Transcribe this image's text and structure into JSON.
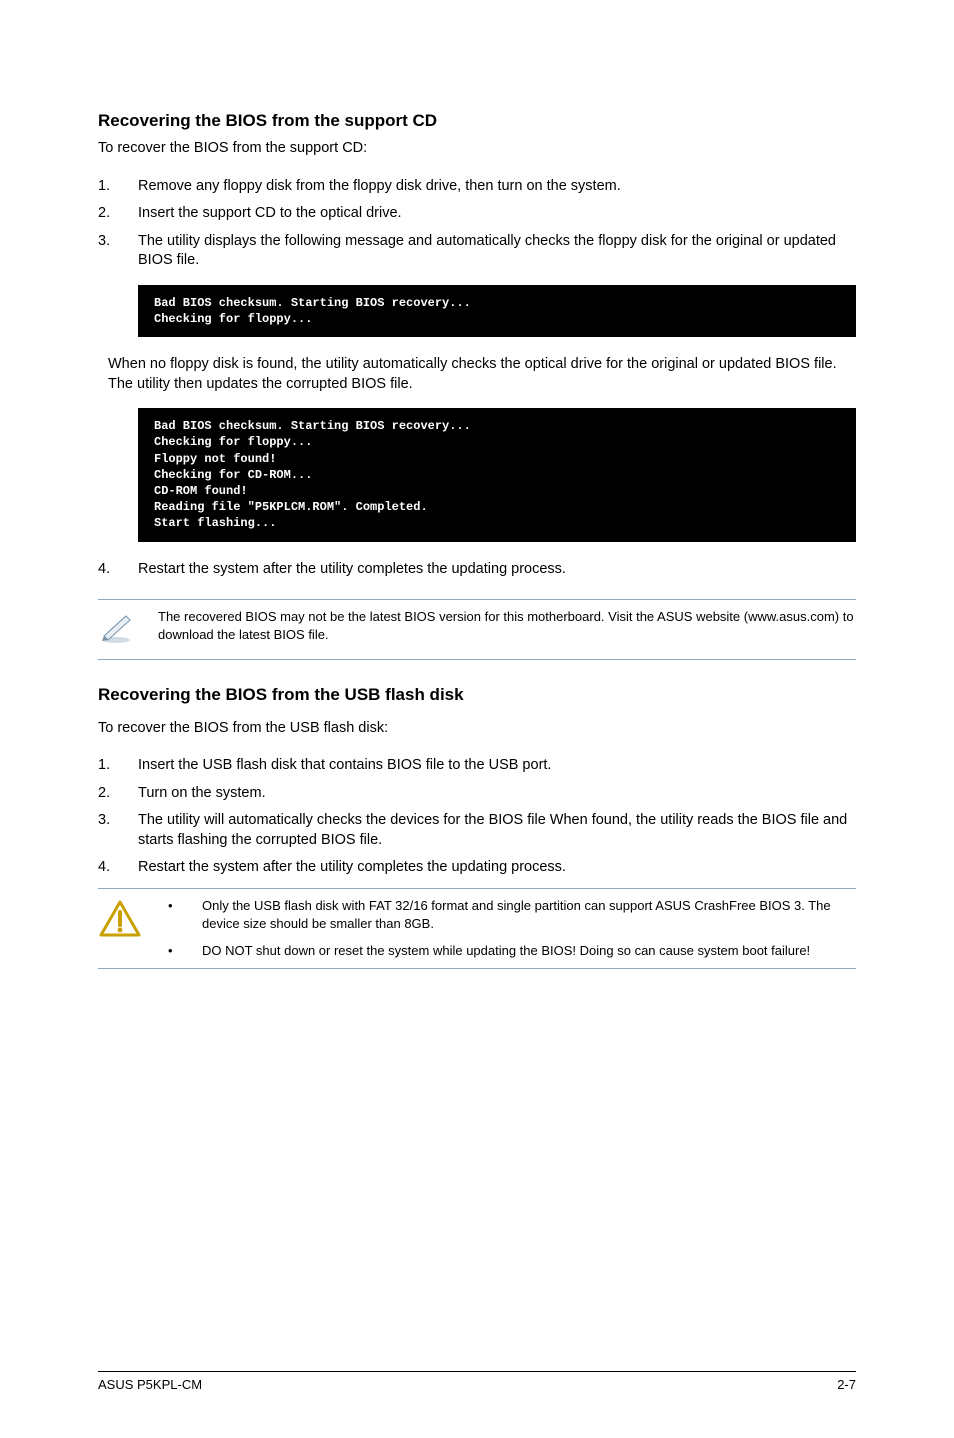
{
  "section1": {
    "heading": "Recovering the BIOS from the support CD",
    "intro": "To recover the BIOS from the support CD:",
    "steps": [
      "Remove any floppy disk from the floppy disk drive, then turn on the system.",
      "Insert the support CD to the optical drive.",
      "The utility displays the following message and automatically checks the floppy disk for the original or updated BIOS file."
    ],
    "term1": "Bad BIOS checksum. Starting BIOS recovery...\nChecking for floppy...",
    "midpara": "When no floppy disk is found, the utility automatically checks the optical drive for the original or updated BIOS file. The utility then updates the corrupted BIOS file.",
    "term2": "Bad BIOS checksum. Starting BIOS recovery...\nChecking for floppy...\nFloppy not found!\nChecking for CD-ROM...\nCD-ROM found!\nReading file \"P5KPLCM.ROM\". Completed.\nStart flashing...",
    "step4": "Restart the system after the utility completes the updating process.",
    "note": "The recovered BIOS may not be the latest BIOS version for this motherboard. Visit the ASUS website (www.asus.com) to download the latest BIOS file."
  },
  "section2": {
    "heading": "Recovering the BIOS from the USB flash disk",
    "intro": "To recover the BIOS from the USB flash disk:",
    "steps": [
      "Insert the USB flash disk that contains BIOS file to the USB port.",
      "Turn on the system.",
      "The utility will automatically checks the devices for the BIOS file When found, the utility reads the BIOS file and starts flashing the corrupted BIOS file.",
      "Restart the system after the utility completes the updating process."
    ],
    "warnings": [
      "Only the USB flash disk with FAT 32/16 format and single partition can support ASUS CrashFree BIOS 3. The device size should be smaller than 8GB.",
      "DO NOT shut down or reset the system while updating the BIOS! Doing so can cause system boot failure!"
    ]
  },
  "footer": {
    "left": "ASUS P5KPL-CM",
    "right": "2-7"
  },
  "icons": {
    "pencil": "pencil-note-icon",
    "warning": "warning-triangle-icon"
  }
}
